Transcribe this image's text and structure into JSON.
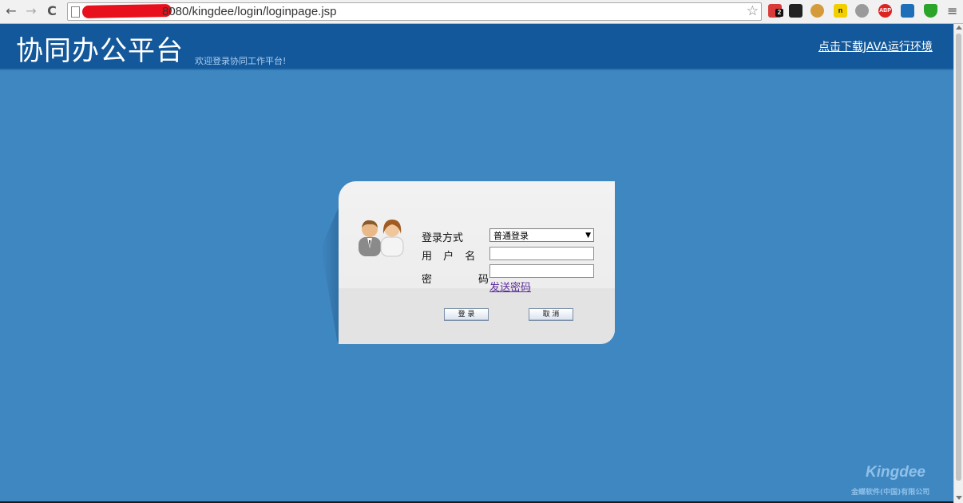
{
  "browser": {
    "url": "8080/kingdee/login/loginpage.jsp",
    "icons": [
      "back-icon",
      "forward-icon",
      "reload-icon",
      "page-icon",
      "bookmark-star-icon",
      "extension-icons",
      "menu-icon"
    ],
    "back": "←",
    "forward": "→",
    "reload": "C",
    "star": "☆",
    "menu": "≡",
    "badge_count": "2",
    "ext_abp": "ABP"
  },
  "header": {
    "title": "协同办公平台",
    "subtitle": "欢迎登录协同工作平台!",
    "jre_link": "点击下载JAVA运行环境"
  },
  "login": {
    "mode_label": "登录方式",
    "mode_value": "普通登录",
    "username_label": "用 户 名",
    "username_value": "",
    "password_label_left": "密",
    "password_label_right": "码",
    "password_value": "",
    "send_password": "发送密码",
    "login_button": "登 录",
    "cancel_button": "取 消"
  },
  "footer": {
    "logo": "Kingdee",
    "company": "金蝶软件(中国)有限公司"
  },
  "colors": {
    "background": "#3f87c0",
    "header": "#13589a",
    "link": "#5b2c9b"
  }
}
